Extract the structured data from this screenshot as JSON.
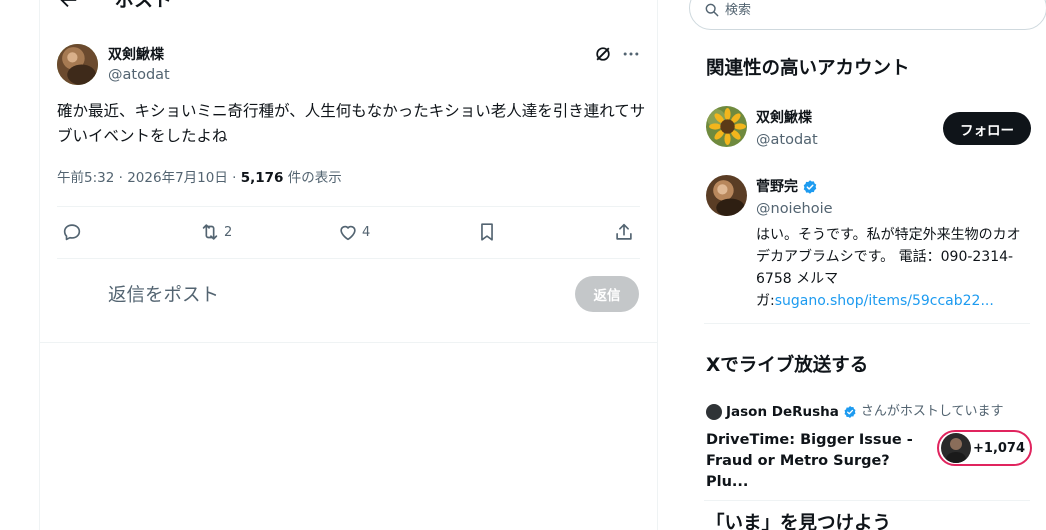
{
  "header": {
    "title": "ポスト"
  },
  "post": {
    "author_name": "双剣鰍楪",
    "author_handle": "@atodat",
    "text": "確か最近、キショいミニ奇行種が、人生何もなかったキショい老人達を引き連れてサブいイベントをしたよね",
    "time": "午前5:32",
    "date": "2026年7月10日",
    "views_count": "5,176",
    "views_label": "件の表示",
    "actions": {
      "reply_count": "",
      "repost_count": "2",
      "like_count": "4"
    }
  },
  "reply_box": {
    "placeholder": "返信をポスト",
    "button_label": "返信"
  },
  "sidebar": {
    "search_placeholder": "検索",
    "relevant_title": "関連性の高いアカウント",
    "accounts": [
      {
        "name": "双剣鰍楪",
        "handle": "@atodat",
        "follow_label": "フォロー"
      },
      {
        "name": "菅野完",
        "handle": "@noiehoie",
        "verified": true,
        "bio_lines": [
          "はい。そうです。私が特定外来生物のカオ",
          "デカアブラムシです。 電話：090-2314-",
          "6758 メルマ"
        ],
        "bio_prefix": "ガ:",
        "bio_link": "sugano.shop/items/59ccab22..."
      }
    ],
    "live_title": "Xでライブ放送する",
    "live": {
      "host_name": "Jason DeRusha",
      "host_suffix": "さんがホストしています",
      "title": "DriveTime: Bigger Issue - Fraud or Metro Surge? Plu...",
      "listeners": "+1,074"
    },
    "next_title": "「いま」を見つけよう"
  },
  "colors": {
    "accent": "#1d9bf0",
    "text": "#0f1419",
    "muted": "#536471",
    "live_ring": "#e0245e"
  }
}
